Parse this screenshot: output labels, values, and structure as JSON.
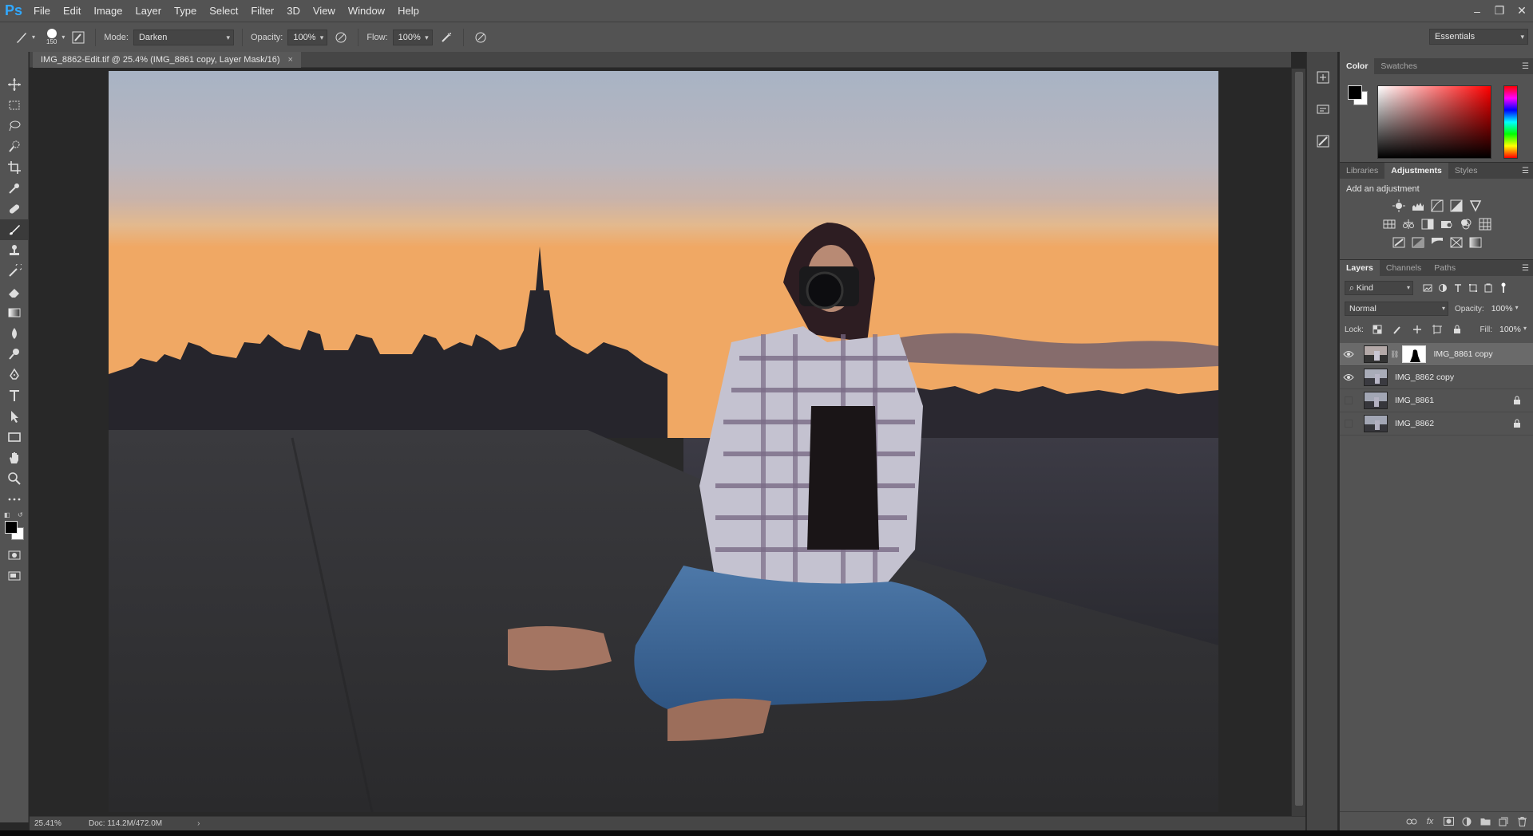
{
  "app": {
    "logo": "Ps"
  },
  "menu": [
    "File",
    "Edit",
    "Image",
    "Layer",
    "Type",
    "Select",
    "Filter",
    "3D",
    "View",
    "Window",
    "Help"
  ],
  "window_controls": {
    "minimize": "–",
    "restore": "❐",
    "close": "✕"
  },
  "options_bar": {
    "brush_size": "150",
    "mode_label": "Mode:",
    "mode_value": "Darken",
    "opacity_label": "Opacity:",
    "opacity_value": "100%",
    "flow_label": "Flow:",
    "flow_value": "100%",
    "workspace": "Essentials"
  },
  "document": {
    "tab_title": "IMG_8862-Edit.tif @ 25.4% (IMG_8861 copy, Layer Mask/16)",
    "tab_close": "×",
    "zoom": "25.41%",
    "doc_size": "Doc: 114.2M/472.0M",
    "status_arrow": "›"
  },
  "color_panel": {
    "tabs": [
      "Color",
      "Swatches"
    ],
    "foreground": "#000000",
    "background": "#ffffff"
  },
  "adjustments_panel": {
    "tabs": [
      "Libraries",
      "Adjustments",
      "Styles"
    ],
    "title": "Add an adjustment"
  },
  "layers_panel": {
    "tabs": [
      "Layers",
      "Channels",
      "Paths"
    ],
    "filter_kind": "Kind",
    "filter_kind_prefix": "⌕",
    "blend_mode": "Normal",
    "opacity_label": "Opacity:",
    "opacity_value": "100%",
    "lock_label": "Lock:",
    "fill_label": "Fill:",
    "fill_value": "100%",
    "layers": [
      {
        "name": "IMG_8861 copy",
        "visible": true,
        "selected": true,
        "has_mask": true,
        "locked": false
      },
      {
        "name": "IMG_8862 copy",
        "visible": true,
        "selected": false,
        "has_mask": false,
        "locked": false
      },
      {
        "name": "IMG_8861",
        "visible": false,
        "selected": false,
        "has_mask": false,
        "locked": true
      },
      {
        "name": "IMG_8862",
        "visible": false,
        "selected": false,
        "has_mask": false,
        "locked": true
      }
    ],
    "footer_icons": [
      "link-icon",
      "fx-icon",
      "add-mask-icon",
      "adjustment-layer-icon",
      "new-group-icon",
      "new-layer-icon",
      "trash-icon"
    ],
    "footer_fx": "fx"
  },
  "tools": [
    "move",
    "marquee",
    "lasso",
    "quick-select",
    "crop",
    "eyedropper",
    "healing",
    "brush",
    "stamp",
    "history-brush",
    "eraser",
    "gradient",
    "blur",
    "dodge",
    "pen",
    "type",
    "path-select",
    "rectangle",
    "hand",
    "zoom",
    "more"
  ],
  "colors": {
    "accent": "#31a8ff",
    "ui_dark": "#535353",
    "ui_darker": "#282828"
  }
}
